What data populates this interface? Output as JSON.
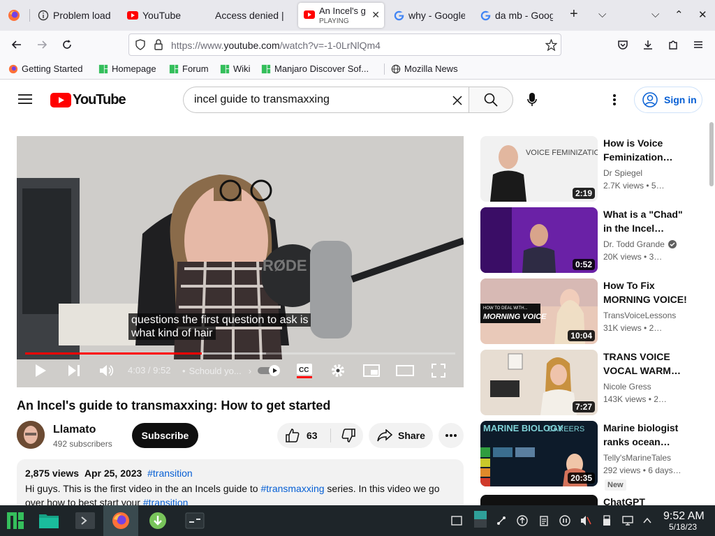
{
  "browser": {
    "tabs": [
      {
        "label": "Problem load",
        "icon": "info-icon"
      },
      {
        "label": "YouTube",
        "icon": "youtube-icon"
      },
      {
        "label": "Access denied |",
        "icon": "none"
      },
      {
        "label": "An Incel's g",
        "sublabel": "PLAYING",
        "icon": "youtube-icon",
        "active": true
      },
      {
        "label": "why - Google",
        "icon": "google-icon"
      },
      {
        "label": "da mb - Goog",
        "icon": "google-icon"
      }
    ],
    "url_prefix": "https://www.",
    "url_domain": "youtube.com",
    "url_path": "/watch?v=-1-0LrNlQm4",
    "bookmarks": [
      {
        "label": "Getting Started",
        "icon": "firefox-icon"
      },
      {
        "label": "Homepage",
        "icon": "manjaro-icon"
      },
      {
        "label": "Forum",
        "icon": "manjaro-icon"
      },
      {
        "label": "Wiki",
        "icon": "manjaro-icon"
      },
      {
        "label": "Manjaro Discover Sof...",
        "icon": "manjaro-icon"
      },
      {
        "label": "Mozilla News",
        "icon": "globe-icon"
      }
    ]
  },
  "youtube": {
    "logo_text": "YouTube",
    "search_value": "incel guide to transmaxxing",
    "sign_in": "Sign in",
    "accent": "#ff0000",
    "link_color": "#065fd4"
  },
  "player": {
    "caption_line1": "questions the first question to ask is",
    "caption_line2": "what kind of hair",
    "time": "4:03 / 9:52",
    "chapter": "Schould yo...",
    "progress_fraction": 0.41,
    "buffered_fraction": 0.56
  },
  "video": {
    "title": "An Incel's guide to transmaxxing: How to get started",
    "channel": "Llamato",
    "subscribers": "492 subscribers",
    "subscribe_label": "Subscribe",
    "likes": "63",
    "share_label": "Share",
    "views": "2,875 views",
    "date": "Apr 25, 2023",
    "hashtag": "#transition",
    "desc_line1_a": "Hi guys. This is the first video in the an Incels guide to ",
    "desc_line1_link": "#transmaxxing",
    "desc_line1_b": " series. In this video we go",
    "desc_line2_a": "over how to best start your ",
    "desc_line2_link": "#transition"
  },
  "related": [
    {
      "title": "How is Voice Feminization…",
      "channel": "Dr Spiegel",
      "views": "2.7K views",
      "age": "5…",
      "duration": "2:19",
      "verified": false,
      "thumb_text": "VOICE FEMINIZATION"
    },
    {
      "title": "What is a \"Chad\" in the Incel…",
      "channel": "Dr. Todd Grande",
      "views": "20K views",
      "age": "3…",
      "duration": "0:52",
      "verified": true
    },
    {
      "title": "How To Fix MORNING VOICE!",
      "channel": "TransVoiceLessons",
      "views": "31K views",
      "age": "2…",
      "duration": "10:04",
      "verified": false,
      "thumb_text": "MORNING VOICE",
      "thumb_small": "HOW TO DEAL WITH..."
    },
    {
      "title": "TRANS VOICE VOCAL WARM…",
      "channel": "Nicole Gress",
      "views": "143K views",
      "age": "2…",
      "duration": "7:27",
      "verified": false
    },
    {
      "title": "Marine biologist ranks ocean…",
      "channel": "Telly'sMarineTales",
      "views": "292 views",
      "age": "6 days…",
      "duration": "20:35",
      "verified": false,
      "badge": "New",
      "thumb_text": "MARINE BIOLOGY",
      "thumb_small": "CAREERS"
    },
    {
      "title": "ChatGPT",
      "channel": "",
      "views": "",
      "age": "",
      "duration": ""
    }
  ],
  "taskbar": {
    "clock_time": "9:52 AM",
    "clock_date": "5/18/23"
  }
}
